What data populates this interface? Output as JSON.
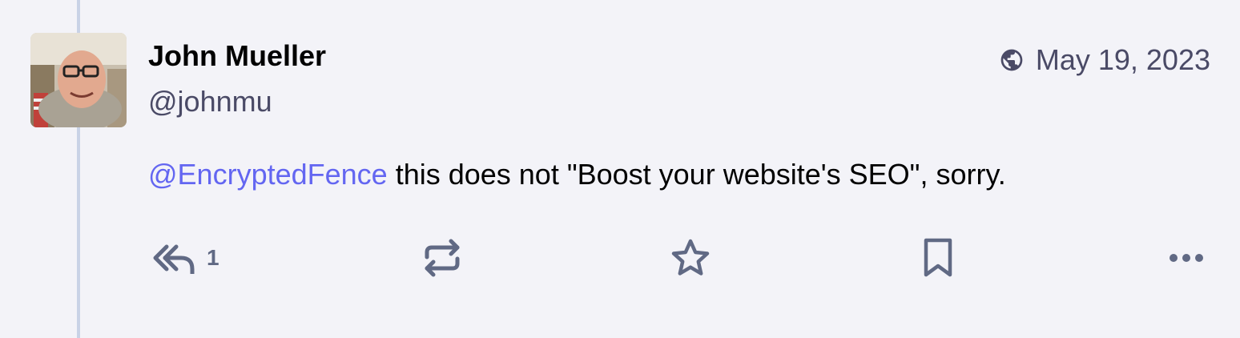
{
  "status": {
    "author": {
      "display_name": "John Mueller",
      "handle": "@johnmu",
      "avatar_icon": "avatar-photo"
    },
    "visibility_icon": "globe-icon",
    "date": "May 19, 2023",
    "content": {
      "mention": "@EncryptedFence",
      "text": " this does not \"Boost your website's SEO\", sorry."
    },
    "actions": {
      "reply": {
        "icon": "reply-all-icon",
        "count": "1"
      },
      "boost": {
        "icon": "retweet-icon"
      },
      "favourite": {
        "icon": "star-icon"
      },
      "bookmark": {
        "icon": "bookmark-icon"
      },
      "more": {
        "icon": "more-horizontal-icon"
      }
    }
  },
  "colors": {
    "background": "#f3f3f8",
    "thread_line": "#c9d2e6",
    "mention": "#6366f1",
    "icon": "#606984",
    "muted_text": "#4a4a66"
  }
}
